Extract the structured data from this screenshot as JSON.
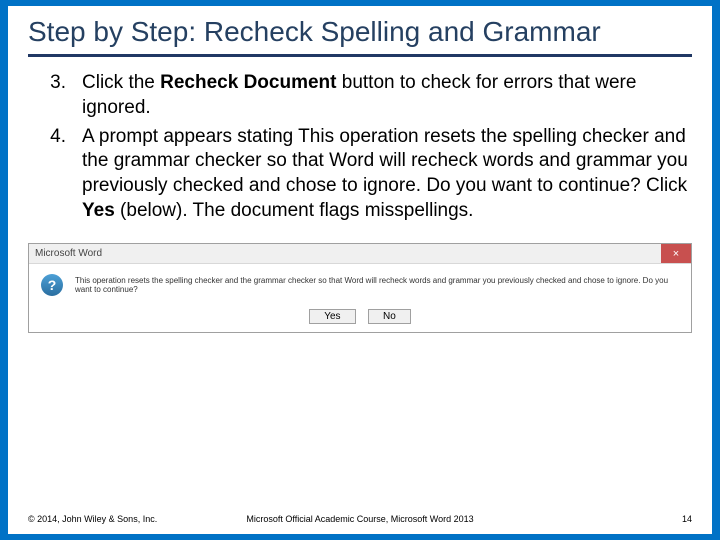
{
  "title": "Step by Step: Recheck Spelling and Grammar",
  "steps": {
    "s3": {
      "num": "3.",
      "pre": "Click the ",
      "bold": "Recheck Document",
      "post": " button to check for errors that were ignored."
    },
    "s4": {
      "num": "4.",
      "pre": "A prompt appears stating This operation resets the spelling checker and the grammar checker so that Word will recheck words and grammar you previously checked and chose to ignore. Do you want to continue? Click ",
      "bold": "Yes",
      "post": " (below). The document flags misspellings."
    }
  },
  "dialog": {
    "title": "Microsoft Word",
    "close": "×",
    "q": "?",
    "msg": "This operation resets the spelling checker and the grammar checker so that Word will recheck words and grammar you previously checked and chose to ignore. Do you want to continue?",
    "yes": "Yes",
    "no": "No"
  },
  "footer": {
    "left": "© 2014, John Wiley & Sons, Inc.",
    "center": "Microsoft Official Academic Course, Microsoft Word 2013",
    "right": "14"
  }
}
